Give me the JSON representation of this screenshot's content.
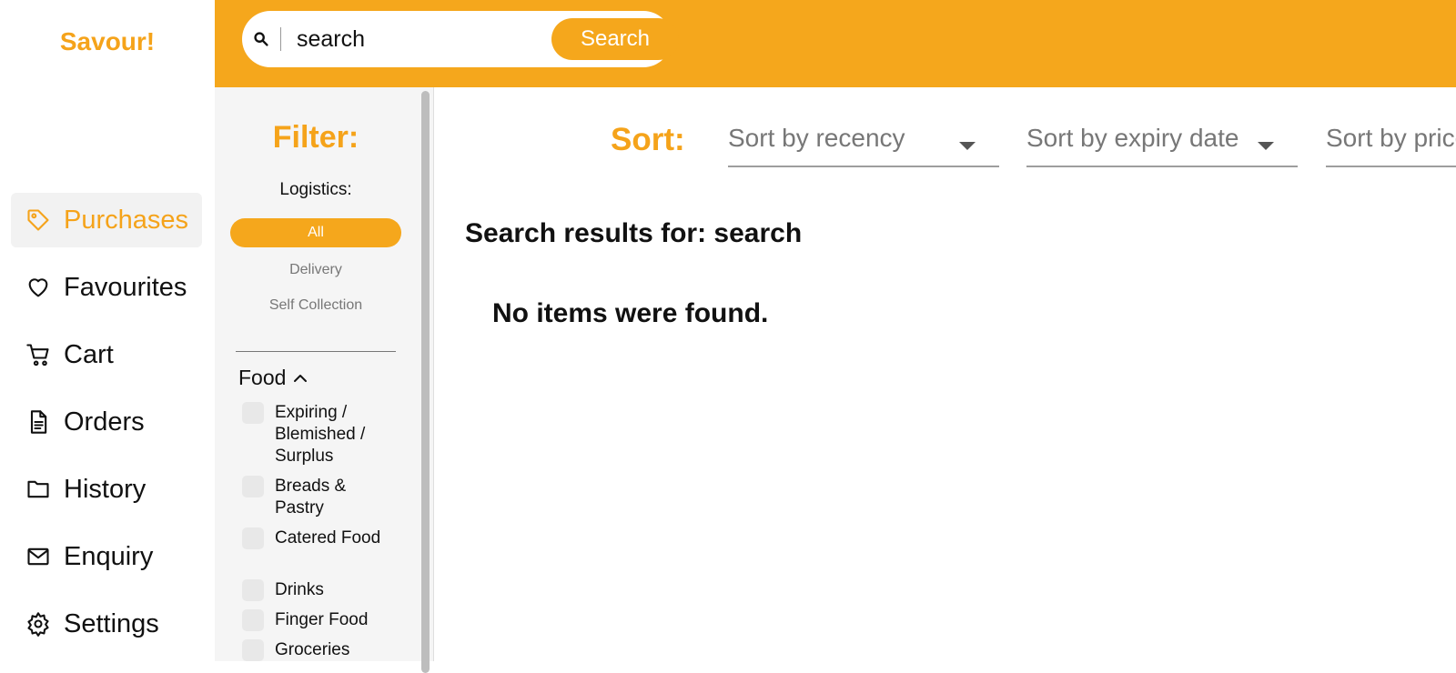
{
  "brand": "Savour!",
  "nav": {
    "items": [
      {
        "label": "Purchases",
        "icon": "tag-icon",
        "active": true
      },
      {
        "label": "Favourites",
        "icon": "heart-icon",
        "active": false
      },
      {
        "label": "Cart",
        "icon": "cart-icon",
        "active": false
      },
      {
        "label": "Orders",
        "icon": "document-icon",
        "active": false
      },
      {
        "label": "History",
        "icon": "folder-icon",
        "active": false
      },
      {
        "label": "Enquiry",
        "icon": "mail-icon",
        "active": false
      },
      {
        "label": "Settings",
        "icon": "gear-icon",
        "active": false
      }
    ]
  },
  "search": {
    "value": "search",
    "button_label": "Search"
  },
  "filter": {
    "title": "Filter:",
    "logistics_label": "Logistics:",
    "logistics_options": [
      "All",
      "Delivery",
      "Self Collection"
    ],
    "selected_logistics": "All",
    "food_label": "Food",
    "food_categories": [
      "Expiring / Blemished / Surplus",
      "Breads & Pastry",
      "Catered Food",
      "Drinks",
      "Finger Food",
      "Groceries"
    ]
  },
  "sort": {
    "label": "Sort:",
    "options": [
      "Sort by recency",
      "Sort by expiry date",
      "Sort by price"
    ]
  },
  "results": {
    "title": "Search results for: search",
    "empty_message": "No items were found."
  },
  "colors": {
    "accent": "#f5a71c",
    "brand_text": "#f5a31a",
    "nav_active_bg": "#f2f2f2",
    "filter_bg": "#f5f5f5"
  }
}
